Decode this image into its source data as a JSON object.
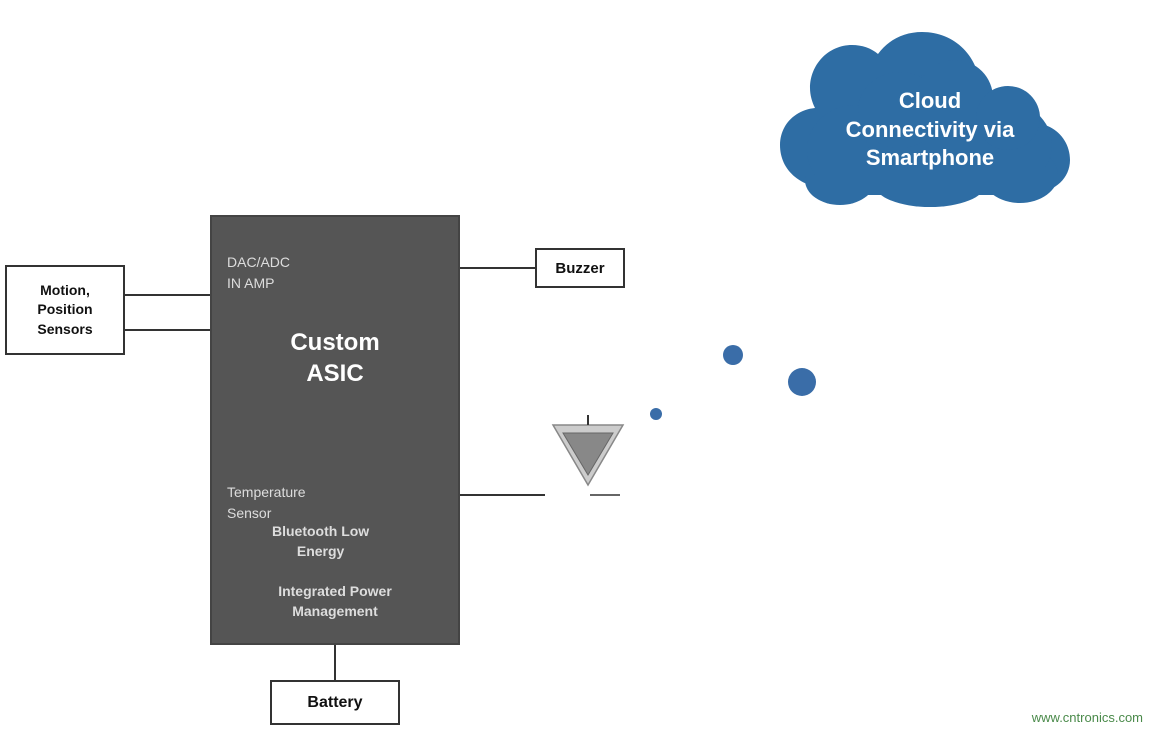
{
  "cloud": {
    "text": "Cloud\nConnectivity via\nSmartphone",
    "line1": "Cloud",
    "line2": "Connectivity via",
    "line3": "Smartphone",
    "color": "#2e6da4"
  },
  "asic": {
    "label_line1": "Custom",
    "label_line2": "ASIC",
    "dac_label": "DAC/ADC\nIN AMP",
    "dac_line1": "DAC/ADC",
    "dac_line2": "IN AMP",
    "temp_label": "Temperature\nSensor",
    "temp_line1": "Temperature",
    "temp_line2": "Sensor",
    "ble_label": "Bluetooth Low\nEnergy",
    "ble_line1": "Bluetooth Low",
    "ble_line2": "Energy",
    "power_label": "Integrated Power\nManagement",
    "power_line1": "Integrated Power",
    "power_line2": "Management"
  },
  "sensors": {
    "text": "Motion,\nPosition\nSensors",
    "line1": "Motion,",
    "line2": "Position",
    "line3": "Sensors"
  },
  "buzzer": {
    "label": "Buzzer"
  },
  "battery": {
    "label": "Battery"
  },
  "watermark": {
    "text": "www.cntronics.com"
  }
}
